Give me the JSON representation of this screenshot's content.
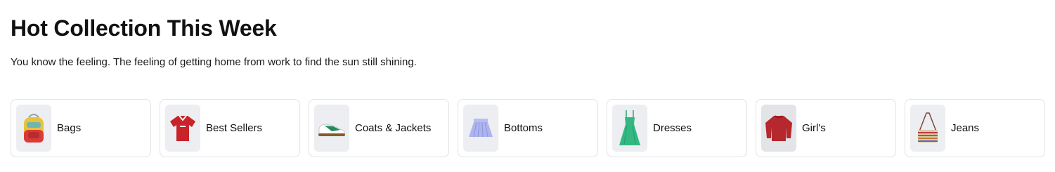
{
  "section": {
    "title": "Hot Collection This Week",
    "subtitle": "You know the feeling. The feeling of getting home from work to find the sun still shining."
  },
  "categories": [
    {
      "label": "Bags",
      "icon": "backpack-icon"
    },
    {
      "label": "Best Sellers",
      "icon": "jersey-icon"
    },
    {
      "label": "Coats & Jackets",
      "icon": "sneaker-icon"
    },
    {
      "label": "Bottoms",
      "icon": "skirt-icon"
    },
    {
      "label": "Dresses",
      "icon": "dress-icon"
    },
    {
      "label": "Girl's",
      "icon": "sweater-icon"
    },
    {
      "label": "Jeans",
      "icon": "crossbody-bag-icon"
    }
  ]
}
